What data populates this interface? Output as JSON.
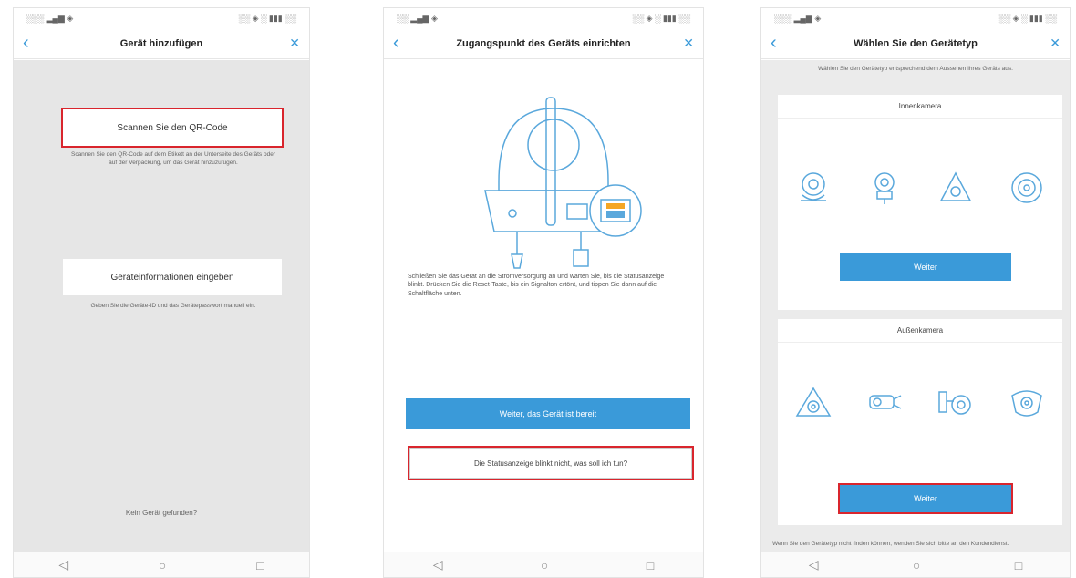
{
  "panel1": {
    "status_left": "░░░ ▂▄▆ ◈",
    "status_right": "░░ ◈ ░ ▮▮▮ ░░",
    "title": "Gerät hinzufügen",
    "option1": {
      "label": "Scannen Sie den QR-Code",
      "desc": "Scannen Sie den QR-Code auf dem Etikett an der Unterseite des Geräts oder auf der Verpackung, um das Gerät hinzuzufügen."
    },
    "option2": {
      "label": "Geräteinformationen eingeben",
      "desc": "Geben Sie die Geräte-ID und das Gerätepasswort manuell ein."
    },
    "footer": "Kein Gerät gefunden?"
  },
  "panel2": {
    "status_left": "░░ ▂▄▆ ◈",
    "status_right": "░░ ◈ ░ ▮▮▮ ░░",
    "title": "Zugangspunkt des Geräts einrichten",
    "desc": "Schließen Sie das Gerät an die Stromversorgung an und warten Sie, bis die Statusanzeige blinkt. Drücken Sie die Reset-Taste, bis ein Signalton ertönt, und tippen Sie dann auf die Schaltfläche unten.",
    "primary_btn": "Weiter, das Gerät ist bereit",
    "secondary_btn": "Die Statusanzeige blinkt nicht, was soll ich tun?"
  },
  "panel3": {
    "status_left": "░░░ ▂▄▆ ◈",
    "status_right": "░░ ◈ ░ ▮▮▮ ░░",
    "title": "Wählen Sie den Gerätetyp",
    "hint": "Wählen Sie den Gerätetyp entsprechend dem Aussehen Ihres Geräts aus.",
    "card1_title": "Innenkamera",
    "card1_btn": "Weiter",
    "card2_title": "Außenkamera",
    "card2_btn": "Weiter",
    "bottom_note": "Wenn Sie den Gerätetyp nicht finden können, wenden Sie sich bitte an den Kundendienst."
  },
  "nav": {
    "back": "‹",
    "close": "✕"
  },
  "sysnav": {
    "back": "◁",
    "home": "○",
    "recent": "□"
  },
  "colors": {
    "accent": "#3a9ad9",
    "highlight": "#d9252d",
    "panel_bg": "#e6e6e6"
  }
}
